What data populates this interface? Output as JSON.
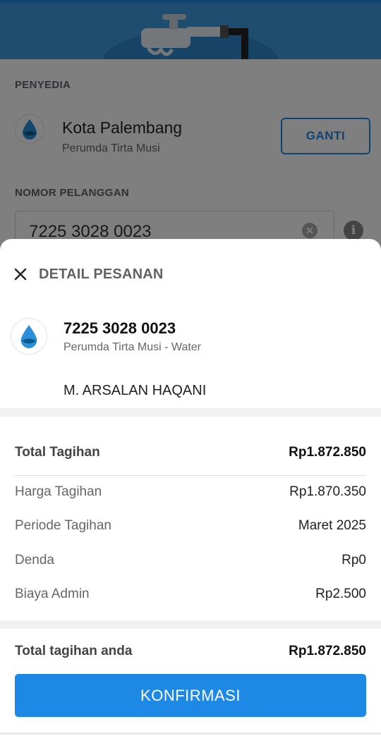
{
  "background": {
    "provider_label": "PENYEDIA",
    "provider_name": "Kota Palembang",
    "provider_subtitle": "Perumda Tirta Musi",
    "change_button": "GANTI",
    "customer_number_label": "NOMOR PELANGGAN",
    "customer_number_value": "7225 3028 0023"
  },
  "sheet": {
    "title": "DETAIL PESANAN",
    "order_number": "7225 3028 0023",
    "order_provider": "Perumda Tirta Musi - Water",
    "customer_name": "M. ARSALAN HAQANI",
    "summary": {
      "total_label": "Total Tagihan",
      "total_value": "Rp1.872.850",
      "rows": [
        {
          "label": "Harga Tagihan",
          "value": "Rp1.870.350"
        },
        {
          "label": "Periode Tagihan",
          "value": "Maret 2025"
        },
        {
          "label": "Denda",
          "value": "Rp0"
        },
        {
          "label": "Biaya Admin",
          "value": "Rp2.500"
        }
      ]
    },
    "footer": {
      "your_total_label": "Total tagihan anda",
      "your_total_value": "Rp1.872.850",
      "confirm_button": "KONFIRMASI"
    }
  },
  "colors": {
    "accent": "#1e88e5",
    "hero": "#3d9be0",
    "overlay": "rgba(0,0,0,0.5)"
  },
  "icons": [
    "water-drop-icon",
    "water-tap-icon",
    "clear-icon",
    "info-icon",
    "close-icon"
  ]
}
